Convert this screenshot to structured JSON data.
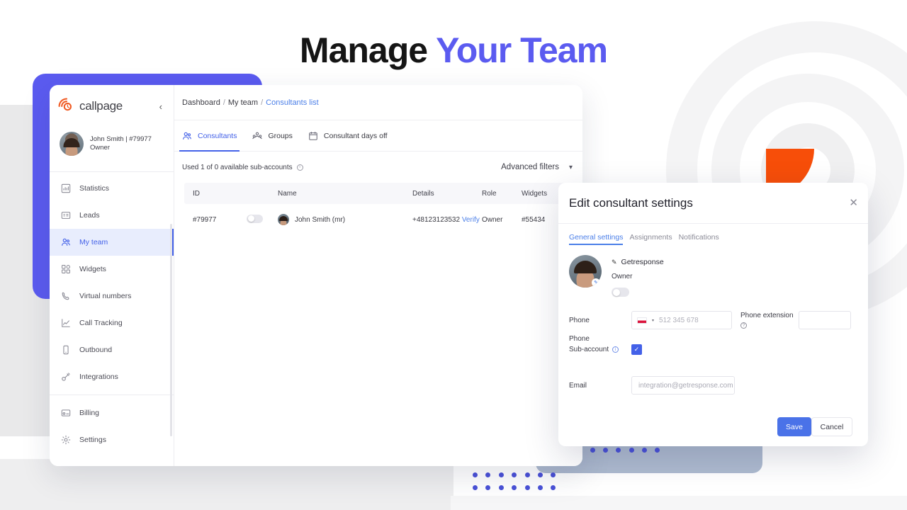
{
  "headline": {
    "plain": "Manage ",
    "accent": "Your Team"
  },
  "colors": {
    "accent_purple": "#5b5bf0",
    "brand_orange": "#f74e09",
    "link_blue": "#4b7fe8",
    "active_blue": "#4361e8",
    "dot_blue": "#4a51d8",
    "card_blue_gray": "#aebbd0"
  },
  "sidebar": {
    "logo_text": "callpage",
    "collapse_icon": "chevron-left",
    "profile": {
      "name": "John Smith | #79977",
      "role": "Owner"
    },
    "items": [
      {
        "label": "Statistics",
        "icon": "bar-chart-icon",
        "active": false
      },
      {
        "label": "Leads",
        "icon": "leads-icon",
        "active": false
      },
      {
        "label": "My team",
        "icon": "users-icon",
        "active": true
      },
      {
        "label": "Widgets",
        "icon": "widgets-icon",
        "active": false
      },
      {
        "label": "Virtual numbers",
        "icon": "phone-icon",
        "active": false
      },
      {
        "label": "Call Tracking",
        "icon": "trend-icon",
        "active": false
      },
      {
        "label": "Outbound",
        "icon": "mobile-icon",
        "active": false
      },
      {
        "label": "Integrations",
        "icon": "plug-icon",
        "active": false
      },
      {
        "label": "Billing",
        "icon": "billing-icon",
        "active": false
      },
      {
        "label": "Settings",
        "icon": "gear-icon",
        "active": false
      }
    ]
  },
  "breadcrumb": {
    "root": "Dashboard",
    "mid": "My team",
    "current": "Consultants list",
    "separator": "/"
  },
  "tabs": [
    {
      "label": "Consultants",
      "icon": "users-icon",
      "active": true
    },
    {
      "label": "Groups",
      "icon": "groups-icon",
      "active": false
    },
    {
      "label": "Consultant days off",
      "icon": "calendar-icon",
      "active": false
    }
  ],
  "subbar": {
    "usage_text": "Used 1 of 0 available sub-accounts",
    "usage_info_icon": "info-icon",
    "filters_label": "Advanced filters",
    "filters_chevron": "chevron-down-icon"
  },
  "table": {
    "columns": [
      "ID",
      "Name",
      "Details",
      "Role",
      "Widgets"
    ],
    "rows": [
      {
        "id": "#79977",
        "toggle": "off",
        "name": "John Smith (mr)",
        "phone": "+48123123532",
        "verify_label": "Verify",
        "role": "Owner",
        "widget": "#55434"
      }
    ]
  },
  "modal": {
    "title": "Edit consultant settings",
    "close_icon": "close-icon",
    "tabs": [
      {
        "label": "General settings",
        "active": true
      },
      {
        "label": "Assignments",
        "active": false
      },
      {
        "label": "Notifications",
        "active": false
      }
    ],
    "profile": {
      "name": "Getresponse",
      "name_edit_icon": "pencil-icon",
      "role": "Owner",
      "toggle": "off",
      "avatar_edit_icon": "pencil-icon"
    },
    "fields": {
      "phone_label": "Phone",
      "phone_placeholder": "512 345 678",
      "phone_country": "PL",
      "ext_label": "Phone extension",
      "ext_info_icon": "question-icon",
      "ext_value": "",
      "phone2_label": "Phone",
      "subaccount_label": "Sub-account",
      "subaccount_info_icon": "info-icon",
      "subaccount_checked": true,
      "email_label": "Email",
      "email_value": "integration@getresponse.com"
    },
    "buttons": {
      "save": "Save",
      "cancel": "Cancel"
    }
  }
}
